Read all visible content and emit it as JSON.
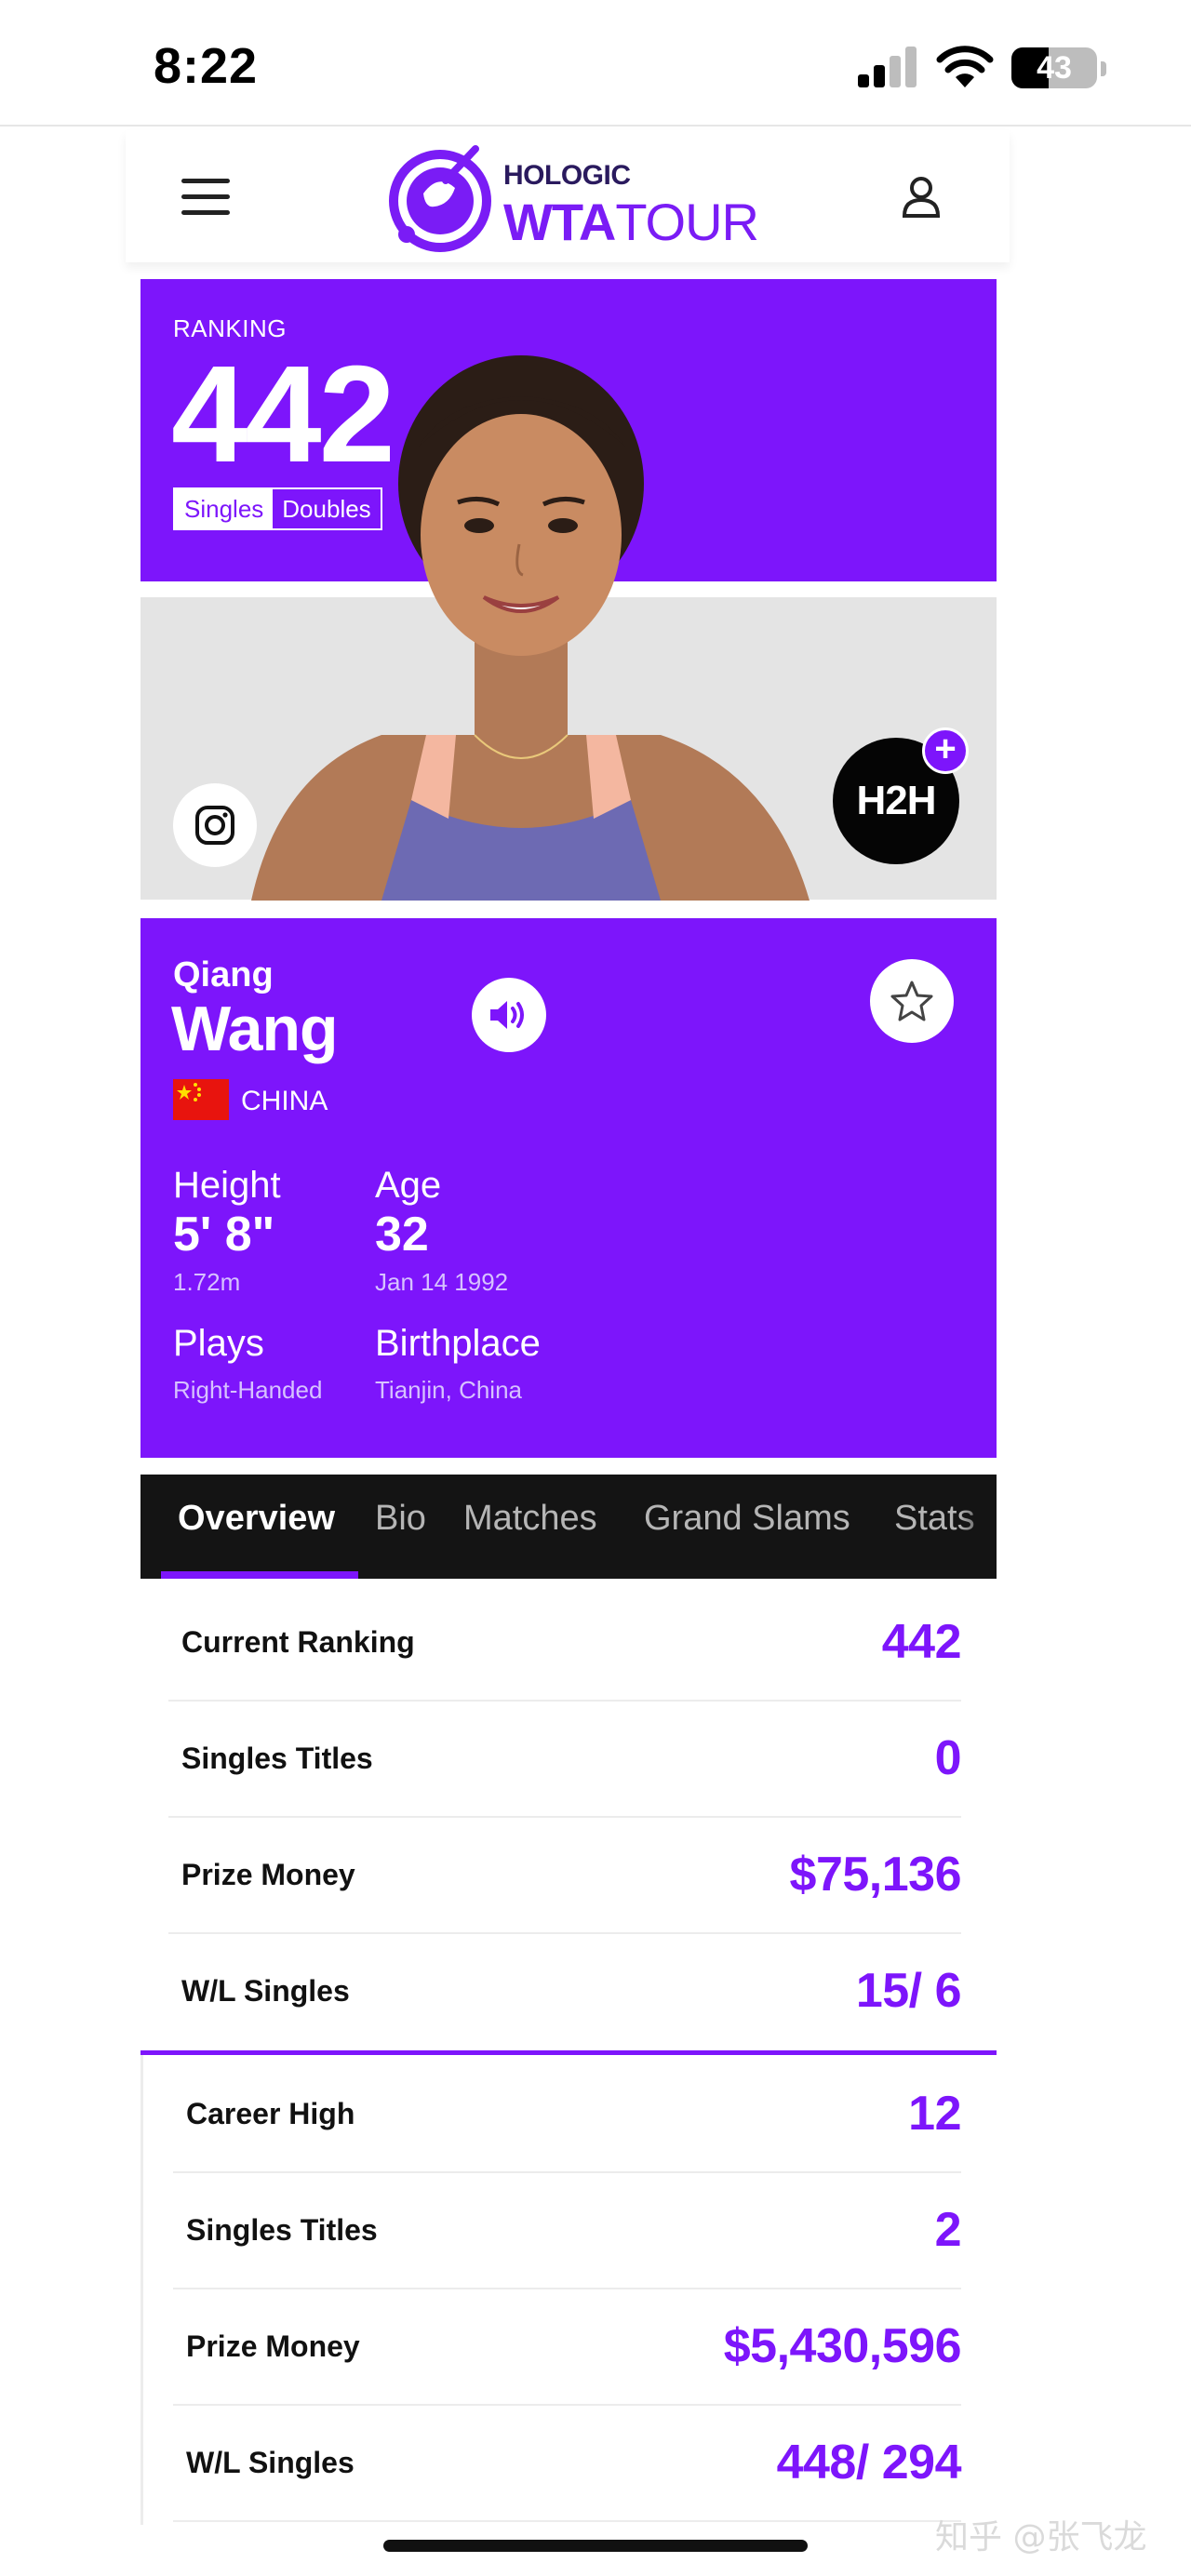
{
  "status_bar": {
    "time": "8:22",
    "battery": "43"
  },
  "header": {
    "logo_top": "HOLOGIC",
    "logo_main_bold": "WTA",
    "logo_main_light": "TOUR",
    "menu_icon": "hamburger-icon",
    "account_icon": "user-icon"
  },
  "ranking": {
    "label": "RANKING",
    "value": "442",
    "singles": "Singles",
    "doubles": "Doubles",
    "selected": "Singles"
  },
  "media": {
    "h2h_label": "H2H",
    "h2h_plus": "+",
    "instagram_icon": "instagram-icon"
  },
  "player": {
    "first_name": "Qiang",
    "last_name": "Wang",
    "country": "CHINA",
    "height_label": "Height",
    "height_value": "5' 8\"",
    "height_metric": "1.72m",
    "age_label": "Age",
    "age_value": "32",
    "birth_date": "Jan 14 1992",
    "plays_label": "Plays",
    "plays_value": "Right-Handed",
    "birthplace_label": "Birthplace",
    "birthplace_value": "Tianjin, China"
  },
  "tabs": [
    "Overview",
    "Bio",
    "Matches",
    "Grand Slams",
    "Stats"
  ],
  "current_stats": [
    {
      "label": "Current Ranking",
      "value": "442"
    },
    {
      "label": "Singles Titles",
      "value": "0"
    },
    {
      "label": "Prize Money",
      "value": "$75,136"
    },
    {
      "label": "W/L Singles",
      "value": "15/ 6"
    }
  ],
  "career_stats": [
    {
      "label": "Career High",
      "value": "12"
    },
    {
      "label": "Singles Titles",
      "value": "2"
    },
    {
      "label": "Prize Money",
      "value": "$5,430,596"
    },
    {
      "label": "W/L Singles",
      "value": "448/ 294"
    }
  ],
  "watermark": "知乎 @张飞龙",
  "colors": {
    "brand_purple": "#7d15fb",
    "tab_bar": "#141414",
    "flag_red": "#e8140e"
  }
}
